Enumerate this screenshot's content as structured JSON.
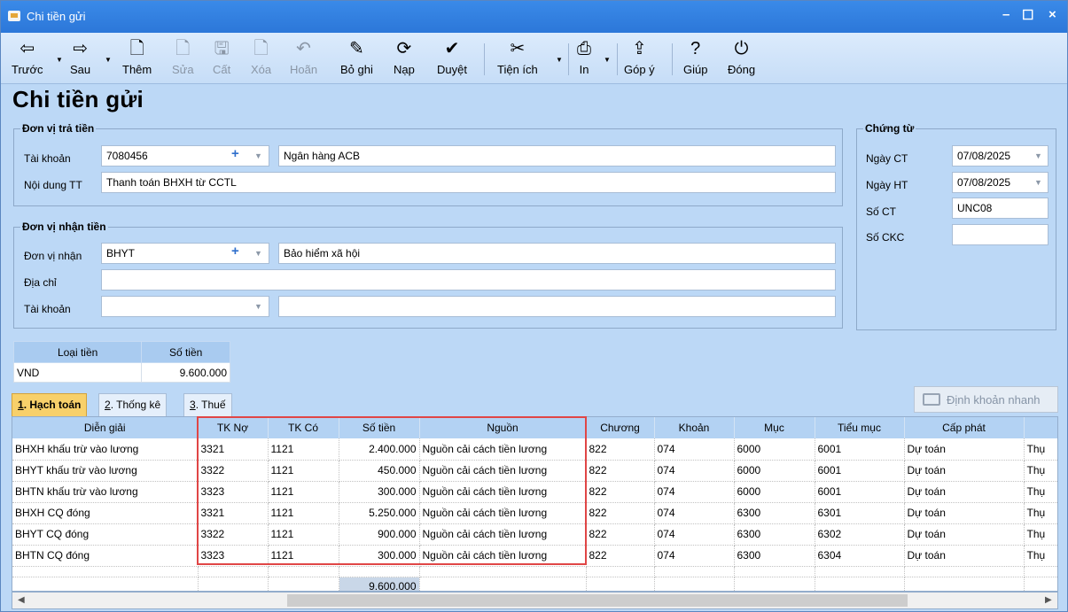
{
  "window": {
    "title": "Chi tiền gửi",
    "controls": [
      "–",
      "☐",
      "×"
    ]
  },
  "toolbar": {
    "items": [
      {
        "label": "Trước",
        "icon": "arrow-left-icon",
        "glyph": "⇦",
        "enabled": true
      },
      {
        "label": "Sau",
        "icon": "arrow-right-icon",
        "glyph": "⇨",
        "enabled": true
      },
      {
        "label": "Thêm",
        "icon": "add-document-icon",
        "glyph": "🗋",
        "enabled": true
      },
      {
        "label": "Sửa",
        "icon": "edit-document-icon",
        "glyph": "🗋",
        "enabled": false
      },
      {
        "label": "Cất",
        "icon": "save-icon",
        "glyph": "🖫",
        "enabled": false
      },
      {
        "label": "Xóa",
        "icon": "delete-document-icon",
        "glyph": "🗋",
        "enabled": false
      },
      {
        "label": "Hoãn",
        "icon": "undo-icon",
        "glyph": "↶",
        "enabled": false
      },
      {
        "label": "Bỏ ghi",
        "icon": "unpost-icon",
        "glyph": "✎",
        "enabled": true
      },
      {
        "label": "Nạp",
        "icon": "refresh-icon",
        "glyph": "⟳",
        "enabled": true
      },
      {
        "label": "Duyệt",
        "icon": "check-icon",
        "glyph": "✔",
        "enabled": true
      },
      {
        "label": "Tiện ích",
        "icon": "tools-icon",
        "glyph": "✂",
        "enabled": true
      },
      {
        "label": "In",
        "icon": "printer-icon",
        "glyph": "⎙",
        "enabled": true
      },
      {
        "label": "Góp ý",
        "icon": "feedback-icon",
        "glyph": "⇪",
        "enabled": true
      },
      {
        "label": "Giúp",
        "icon": "help-icon",
        "glyph": "?",
        "enabled": true
      },
      {
        "label": "Đóng",
        "icon": "power-icon",
        "glyph": "⏻",
        "enabled": true
      }
    ]
  },
  "page_title": "Chi tiền gửi",
  "payer": {
    "legend": "Đơn vị trả tiền",
    "account_label": "Tài khoản",
    "account_value": "7080456",
    "bank_name": "Ngân hàng ACB",
    "content_label": "Nội dung TT",
    "content_value": "Thanh toán BHXH từ CCTL"
  },
  "receiver": {
    "legend": "Đơn vị nhận tiền",
    "unit_label": "Đơn vị nhận",
    "unit_value": "BHYT",
    "unit_name": "Bảo hiểm xã hội",
    "address_label": "Địa chỉ",
    "address_value": "",
    "account_label": "Tài khoản",
    "account_value": "",
    "account_name": ""
  },
  "voucher": {
    "legend": "Chứng từ",
    "date_ct_label": "Ngày CT",
    "date_ct": "07/08/2025",
    "date_ht_label": "Ngày HT",
    "date_ht": "07/08/2025",
    "no_ct_label": "Số CT",
    "no_ct": "UNC08",
    "no_ckc_label": "Số CKC",
    "no_ckc": ""
  },
  "currency": {
    "headers": [
      "Loại tiền",
      "Số tiền"
    ],
    "row": [
      "VND",
      "9.600.000"
    ]
  },
  "tabs": [
    {
      "key": "1",
      "rest": ". Hạch toán",
      "active": true
    },
    {
      "key": "2",
      "rest": ". Thống kê",
      "active": false
    },
    {
      "key": "3",
      "rest": ". Thuế",
      "active": false
    }
  ],
  "quick_entry_label": "Định khoản nhanh",
  "grid": {
    "columns": [
      "Diễn giải",
      "TK Nợ",
      "TK Có",
      "Số tiền",
      "Nguồn",
      "Chương",
      "Khoản",
      "Mục",
      "Tiểu mục",
      "Cấp phát",
      "Thụ"
    ],
    "rows": [
      [
        "BHXH khấu trừ vào lương",
        "3321",
        "1121",
        "2.400.000",
        "Nguồn cải cách tiền lương",
        "822",
        "074",
        "6000",
        "6001",
        "Dự toán",
        "Thụ"
      ],
      [
        "BHYT khấu trừ vào lương",
        "3322",
        "1121",
        "450.000",
        "Nguồn cải cách tiền lương",
        "822",
        "074",
        "6000",
        "6001",
        "Dự toán",
        "Thụ"
      ],
      [
        "BHTN khấu trừ vào lương",
        "3323",
        "1121",
        "300.000",
        "Nguồn cải cách tiền lương",
        "822",
        "074",
        "6000",
        "6001",
        "Dự toán",
        "Thụ"
      ],
      [
        "BHXH CQ đóng",
        "3321",
        "1121",
        "5.250.000",
        "Nguồn cải cách tiền lương",
        "822",
        "074",
        "6300",
        "6301",
        "Dự toán",
        "Thụ"
      ],
      [
        "BHYT CQ đóng",
        "3322",
        "1121",
        "900.000",
        "Nguồn cải cách tiền lương",
        "822",
        "074",
        "6300",
        "6302",
        "Dự toán",
        "Thụ"
      ],
      [
        "BHTN CQ đóng",
        "3323",
        "1121",
        "300.000",
        "Nguồn cải cách tiền lương",
        "822",
        "074",
        "6300",
        "6304",
        "Dự toán",
        "Thụ"
      ]
    ],
    "total": "9.600.000"
  },
  "colors": {
    "titlebar": "#2c77d9",
    "highlight": "#e04646",
    "active_tab": "#f8d06a"
  }
}
